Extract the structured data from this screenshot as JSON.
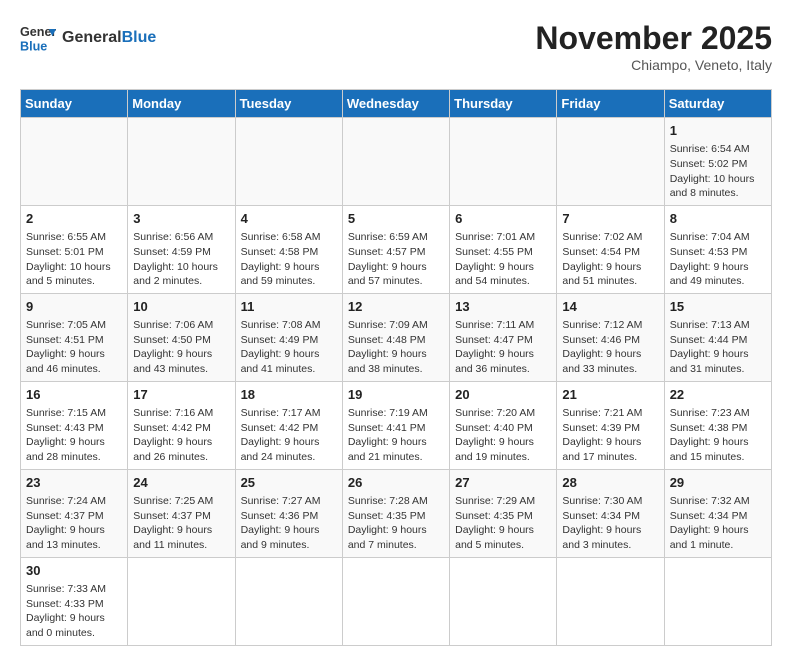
{
  "header": {
    "logo_general": "General",
    "logo_blue": "Blue",
    "month_year": "November 2025",
    "location": "Chiampo, Veneto, Italy"
  },
  "days_of_week": [
    "Sunday",
    "Monday",
    "Tuesday",
    "Wednesday",
    "Thursday",
    "Friday",
    "Saturday"
  ],
  "weeks": [
    [
      {
        "day": "",
        "info": ""
      },
      {
        "day": "",
        "info": ""
      },
      {
        "day": "",
        "info": ""
      },
      {
        "day": "",
        "info": ""
      },
      {
        "day": "",
        "info": ""
      },
      {
        "day": "",
        "info": ""
      },
      {
        "day": "1",
        "info": "Sunrise: 6:54 AM\nSunset: 5:02 PM\nDaylight: 10 hours and 8 minutes."
      }
    ],
    [
      {
        "day": "2",
        "info": "Sunrise: 6:55 AM\nSunset: 5:01 PM\nDaylight: 10 hours and 5 minutes."
      },
      {
        "day": "3",
        "info": "Sunrise: 6:56 AM\nSunset: 4:59 PM\nDaylight: 10 hours and 2 minutes."
      },
      {
        "day": "4",
        "info": "Sunrise: 6:58 AM\nSunset: 4:58 PM\nDaylight: 9 hours and 59 minutes."
      },
      {
        "day": "5",
        "info": "Sunrise: 6:59 AM\nSunset: 4:57 PM\nDaylight: 9 hours and 57 minutes."
      },
      {
        "day": "6",
        "info": "Sunrise: 7:01 AM\nSunset: 4:55 PM\nDaylight: 9 hours and 54 minutes."
      },
      {
        "day": "7",
        "info": "Sunrise: 7:02 AM\nSunset: 4:54 PM\nDaylight: 9 hours and 51 minutes."
      },
      {
        "day": "8",
        "info": "Sunrise: 7:04 AM\nSunset: 4:53 PM\nDaylight: 9 hours and 49 minutes."
      }
    ],
    [
      {
        "day": "9",
        "info": "Sunrise: 7:05 AM\nSunset: 4:51 PM\nDaylight: 9 hours and 46 minutes."
      },
      {
        "day": "10",
        "info": "Sunrise: 7:06 AM\nSunset: 4:50 PM\nDaylight: 9 hours and 43 minutes."
      },
      {
        "day": "11",
        "info": "Sunrise: 7:08 AM\nSunset: 4:49 PM\nDaylight: 9 hours and 41 minutes."
      },
      {
        "day": "12",
        "info": "Sunrise: 7:09 AM\nSunset: 4:48 PM\nDaylight: 9 hours and 38 minutes."
      },
      {
        "day": "13",
        "info": "Sunrise: 7:11 AM\nSunset: 4:47 PM\nDaylight: 9 hours and 36 minutes."
      },
      {
        "day": "14",
        "info": "Sunrise: 7:12 AM\nSunset: 4:46 PM\nDaylight: 9 hours and 33 minutes."
      },
      {
        "day": "15",
        "info": "Sunrise: 7:13 AM\nSunset: 4:44 PM\nDaylight: 9 hours and 31 minutes."
      }
    ],
    [
      {
        "day": "16",
        "info": "Sunrise: 7:15 AM\nSunset: 4:43 PM\nDaylight: 9 hours and 28 minutes."
      },
      {
        "day": "17",
        "info": "Sunrise: 7:16 AM\nSunset: 4:42 PM\nDaylight: 9 hours and 26 minutes."
      },
      {
        "day": "18",
        "info": "Sunrise: 7:17 AM\nSunset: 4:42 PM\nDaylight: 9 hours and 24 minutes."
      },
      {
        "day": "19",
        "info": "Sunrise: 7:19 AM\nSunset: 4:41 PM\nDaylight: 9 hours and 21 minutes."
      },
      {
        "day": "20",
        "info": "Sunrise: 7:20 AM\nSunset: 4:40 PM\nDaylight: 9 hours and 19 minutes."
      },
      {
        "day": "21",
        "info": "Sunrise: 7:21 AM\nSunset: 4:39 PM\nDaylight: 9 hours and 17 minutes."
      },
      {
        "day": "22",
        "info": "Sunrise: 7:23 AM\nSunset: 4:38 PM\nDaylight: 9 hours and 15 minutes."
      }
    ],
    [
      {
        "day": "23",
        "info": "Sunrise: 7:24 AM\nSunset: 4:37 PM\nDaylight: 9 hours and 13 minutes."
      },
      {
        "day": "24",
        "info": "Sunrise: 7:25 AM\nSunset: 4:37 PM\nDaylight: 9 hours and 11 minutes."
      },
      {
        "day": "25",
        "info": "Sunrise: 7:27 AM\nSunset: 4:36 PM\nDaylight: 9 hours and 9 minutes."
      },
      {
        "day": "26",
        "info": "Sunrise: 7:28 AM\nSunset: 4:35 PM\nDaylight: 9 hours and 7 minutes."
      },
      {
        "day": "27",
        "info": "Sunrise: 7:29 AM\nSunset: 4:35 PM\nDaylight: 9 hours and 5 minutes."
      },
      {
        "day": "28",
        "info": "Sunrise: 7:30 AM\nSunset: 4:34 PM\nDaylight: 9 hours and 3 minutes."
      },
      {
        "day": "29",
        "info": "Sunrise: 7:32 AM\nSunset: 4:34 PM\nDaylight: 9 hours and 1 minute."
      }
    ],
    [
      {
        "day": "30",
        "info": "Sunrise: 7:33 AM\nSunset: 4:33 PM\nDaylight: 9 hours and 0 minutes."
      },
      {
        "day": "",
        "info": ""
      },
      {
        "day": "",
        "info": ""
      },
      {
        "day": "",
        "info": ""
      },
      {
        "day": "",
        "info": ""
      },
      {
        "day": "",
        "info": ""
      },
      {
        "day": "",
        "info": ""
      }
    ]
  ]
}
